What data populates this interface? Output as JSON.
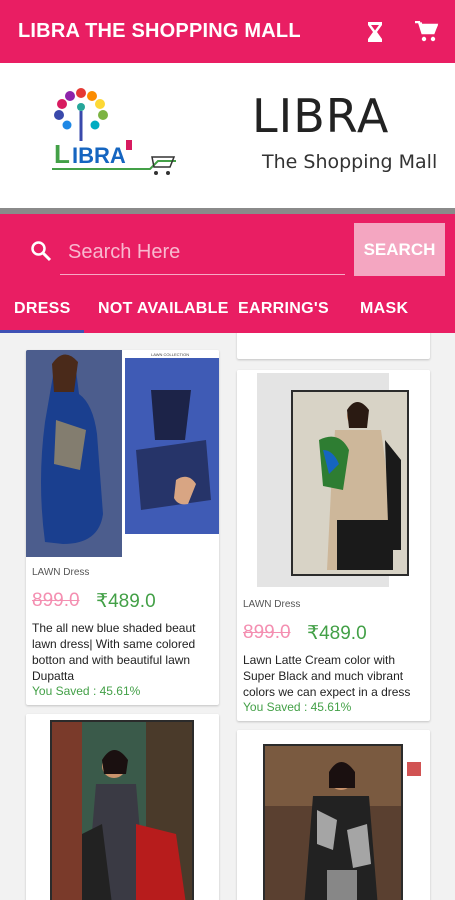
{
  "appbar": {
    "title": "LIBRA THE SHOPPING MALL",
    "hourglass_icon": "hourglass-icon",
    "cart_icon": "cart-icon",
    "color": "#e91e63"
  },
  "header": {
    "logo_text": "LIBRA",
    "brand": "LIBRA",
    "tagline": "The Shopping Mall"
  },
  "search": {
    "placeholder": "Search Here",
    "button_label": "SEARCH"
  },
  "tabs": [
    {
      "label": "DRESS",
      "selected": true
    },
    {
      "label": "NOT AVAILABLE"
    },
    {
      "label": "EARRING'S"
    },
    {
      "label": "MASK"
    }
  ],
  "products": [
    {
      "category": "LAWN Dress",
      "old_price": "899.0",
      "new_price": "₹489.0",
      "description": "The all new blue shaded beaut lawn dress| With same colored botton and with beautiful lawn Dupatta",
      "saved": "You Saved :  45.61%"
    },
    {
      "category": "LAWN Dress",
      "old_price": "899.0",
      "new_price": "₹489.0",
      "description": "Lawn Latte Cream color with Super Black and much vibrant colors we can expect in a dress",
      "saved": "You Saved :  45.61%"
    },
    {},
    {}
  ],
  "colors": {
    "accent": "#e91e63",
    "strike_price": "#f48fb1",
    "price": "#43a047",
    "tab_indicator": "#3f51b5"
  }
}
